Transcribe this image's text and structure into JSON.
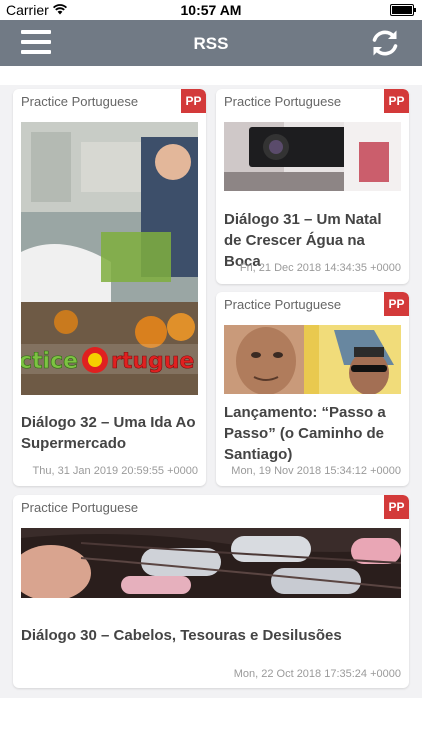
{
  "status_bar": {
    "carrier": "Carrier",
    "time": "10:57 AM"
  },
  "navbar": {
    "title": "RSS"
  },
  "cards": [
    {
      "source": "Practice Portuguese",
      "badge": "PP",
      "title": "Diálogo 32 – Uma Ida Ao Supermercado",
      "date": "Thu, 31 Jan 2019 20:59:55 +0000"
    },
    {
      "source": "Practice Portuguese",
      "badge": "PP",
      "title": "Diálogo 31 – Um Natal de Crescer Água na Boca",
      "date": "Fri, 21 Dec 2018 14:34:35 +0000"
    },
    {
      "source": "Practice Portuguese",
      "badge": "PP",
      "title": "Lançamento: “Passo a Passo” (o Caminho de Santiago)",
      "date": "Mon, 19 Nov 2018 15:34:12 +0000"
    },
    {
      "source": "Practice Portuguese",
      "badge": "PP",
      "title": "Diálogo 30 – Cabelos, Tesouras e Desilusões",
      "date": "Mon, 22 Oct 2018 17:35:24 +0000"
    }
  ],
  "colors": {
    "navbar": "#717a85",
    "badge": "#d33a3a",
    "background": "#f2f2f4"
  }
}
